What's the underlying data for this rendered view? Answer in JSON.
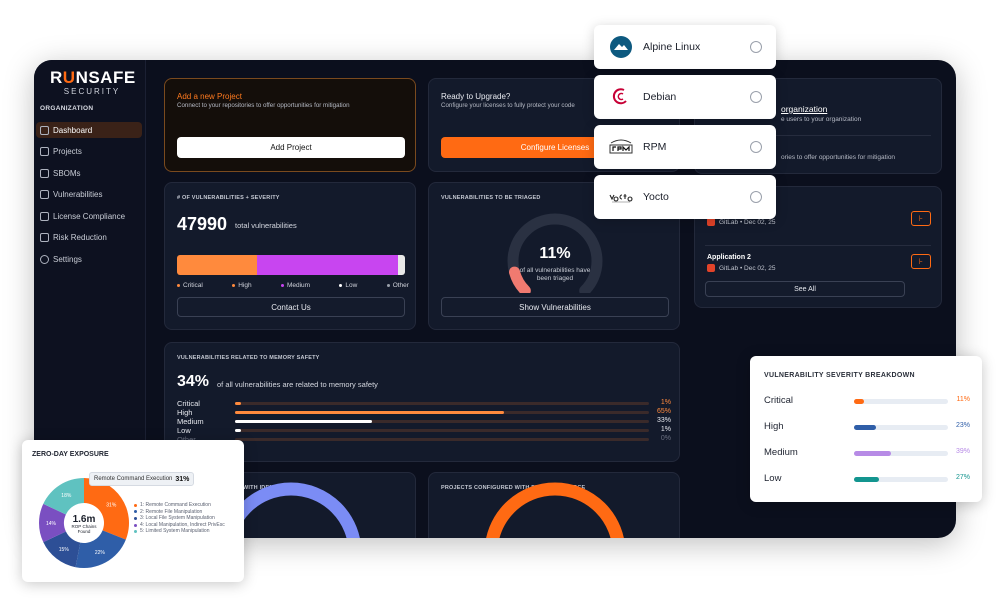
{
  "brand": {
    "logo_prefix": "R",
    "logo_u": "U",
    "logo_suffix": "NSAFE",
    "logo_sub": "SECURITY"
  },
  "sidebar": {
    "section_label": "ORGANIZATION",
    "items": [
      {
        "label": "Dashboard",
        "icon": "dashboard-icon"
      },
      {
        "label": "Projects",
        "icon": "projects-icon"
      },
      {
        "label": "SBOMs",
        "icon": "sbom-icon"
      },
      {
        "label": "Vulnerabilities",
        "icon": "vulnerabilities-icon"
      },
      {
        "label": "License Compliance",
        "icon": "license-icon"
      },
      {
        "label": "Risk Reduction",
        "icon": "risk-icon"
      },
      {
        "label": "Settings",
        "icon": "gear-icon"
      }
    ]
  },
  "promo_project": {
    "title": "Add a new Project",
    "subtitle": "Connect to your repositories to offer opportunities for mitigation",
    "button": "Add Project"
  },
  "promo_upgrade": {
    "title": "Ready to Upgrade?",
    "subtitle": "Configure your licenses to fully protect your code",
    "button": "Configure Licenses"
  },
  "vuln_card": {
    "title": "# OF VULNERABILITIES + SEVERITY",
    "total": "47990",
    "total_label": "total vulnerabilities",
    "legend": [
      "Critical",
      "High",
      "Medium",
      "Low",
      "Other"
    ],
    "button": "Contact Us"
  },
  "triage_card": {
    "title": "VULNERABILITIES TO BE TRIAGED",
    "percent": "11%",
    "label_line1": "of all vulnerabilities have",
    "label_line2": "been triaged",
    "button": "Show Vulnerabilities"
  },
  "memory_card": {
    "title": "VULNERABILITIES RELATED TO MEMORY SAFETY",
    "percent": "34%",
    "label": "of all vulnerabilities are related to memory safety",
    "rows": [
      {
        "label": "Critical",
        "value": "1%"
      },
      {
        "label": "High",
        "value": "65%"
      },
      {
        "label": "Medium",
        "value": "33%"
      },
      {
        "label": "Low",
        "value": "1%"
      },
      {
        "label": "Other",
        "value": "0%"
      }
    ]
  },
  "bottom_cards": {
    "left_title": "WITH IDENTIFY",
    "right_title": "PROJECTS CONFIGURED WITH PROTECT SOURCE"
  },
  "right_org": {
    "title": "organization",
    "line1": "e users to your organization",
    "line2": "ories to offer opportunities for mitigation"
  },
  "apps": [
    {
      "name": "",
      "source": "GitLab",
      "date": "Dec 02, 25"
    },
    {
      "name": "Application 2",
      "source": "GitLab",
      "date": "Dec 02, 25"
    }
  ],
  "see_all": "See All",
  "distros": [
    {
      "name": "Alpine Linux",
      "logo": "alpine-icon"
    },
    {
      "name": "Debian",
      "logo": "debian-icon"
    },
    {
      "name": "RPM",
      "logo": "rpm-icon"
    },
    {
      "name": "Yocto",
      "logo": "yocto-icon"
    }
  ],
  "breakdown": {
    "title": "VULNERABILITY SEVERITY BREAKDOWN",
    "rows": [
      {
        "label": "Critical",
        "value": "11%",
        "pct": 11,
        "color": "#ff6a13"
      },
      {
        "label": "High",
        "value": "23%",
        "pct": 23,
        "color": "#2f5ea8"
      },
      {
        "label": "Medium",
        "value": "39%",
        "pct": 39,
        "color": "#b78be6"
      },
      {
        "label": "Low",
        "value": "27%",
        "pct": 27,
        "color": "#13958f"
      }
    ]
  },
  "zeroday": {
    "title": "ZERO-DAY EXPOSURE",
    "tooltip_label": "Remote Command Execution",
    "tooltip_value": "31%",
    "center_value": "1.6m",
    "center_label1": "ROP Chains",
    "center_label2": "Found",
    "slices": [
      {
        "label": "1: Remote Command Execution",
        "value": 31,
        "text": "31%",
        "color": "#ff6a13"
      },
      {
        "label": "2: Remote File Manipulation",
        "value": 22,
        "text": "22%",
        "color": "#2f5ea8"
      },
      {
        "label": "3: Local File System Manipulation",
        "value": 15,
        "text": "15%",
        "color": "#2d4f96"
      },
      {
        "label": "4: Local Manipulation, Indirect PrivEsc",
        "value": 14,
        "text": "14%",
        "color": "#7a4fc1"
      },
      {
        "label": "5: Limited System Manipulation",
        "value": 18,
        "text": "18%",
        "color": "#5fc2c0"
      }
    ]
  },
  "colors": {
    "accent": "#ff6a13",
    "critical": "#ff8a3d",
    "high": "#c845f0",
    "medium": "#c845f0",
    "other": "#e8e8e8"
  },
  "severity_split": {
    "critical": 35,
    "high_medium": 62,
    "other": 3
  },
  "triage_fraction": 0.11,
  "memory_fill": [
    1,
    65,
    33,
    1,
    0
  ]
}
